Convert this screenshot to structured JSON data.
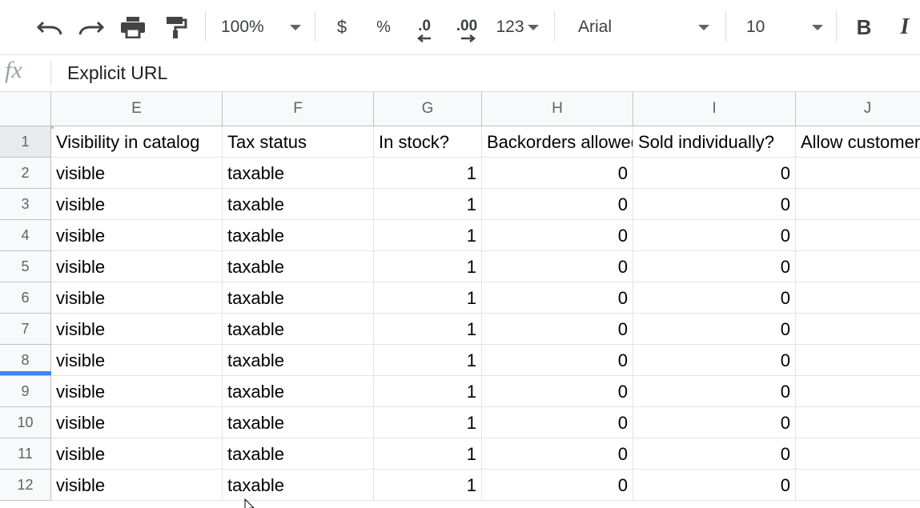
{
  "toolbar": {
    "undo_icon": "undo-icon",
    "redo_icon": "redo-icon",
    "print_icon": "print-icon",
    "paint_format_icon": "paint-format-icon",
    "zoom": "100%",
    "currency": "$",
    "percent": "%",
    "decrease_decimal": ".0",
    "increase_decimal": ".00",
    "more_formats": "123",
    "font": "Arial",
    "font_size": "10",
    "bold": "B",
    "italic": "I"
  },
  "formula_bar": {
    "fx": "fx",
    "value": "Explicit URL"
  },
  "columns": [
    "E",
    "F",
    "G",
    "H",
    "I",
    "J"
  ],
  "rows": [
    {
      "num": "1",
      "cells": [
        "Visibility in catalog",
        "Tax status",
        "In stock?",
        "Backorders allowed?",
        "Sold individually?",
        "Allow customer reviews?"
      ]
    },
    {
      "num": "2",
      "cells": [
        "visible",
        "taxable",
        "1",
        "0",
        "0",
        ""
      ]
    },
    {
      "num": "3",
      "cells": [
        "visible",
        "taxable",
        "1",
        "0",
        "0",
        ""
      ]
    },
    {
      "num": "4",
      "cells": [
        "visible",
        "taxable",
        "1",
        "0",
        "0",
        ""
      ]
    },
    {
      "num": "5",
      "cells": [
        "visible",
        "taxable",
        "1",
        "0",
        "0",
        ""
      ]
    },
    {
      "num": "6",
      "cells": [
        "visible",
        "taxable",
        "1",
        "0",
        "0",
        ""
      ]
    },
    {
      "num": "7",
      "cells": [
        "visible",
        "taxable",
        "1",
        "0",
        "0",
        ""
      ]
    },
    {
      "num": "8",
      "cells": [
        "visible",
        "taxable",
        "1",
        "0",
        "0",
        ""
      ]
    },
    {
      "num": "9",
      "cells": [
        "visible",
        "taxable",
        "1",
        "0",
        "0",
        ""
      ]
    },
    {
      "num": "10",
      "cells": [
        "visible",
        "taxable",
        "1",
        "0",
        "0",
        ""
      ]
    },
    {
      "num": "11",
      "cells": [
        "visible",
        "taxable",
        "1",
        "0",
        "0",
        ""
      ]
    },
    {
      "num": "12",
      "cells": [
        "visible",
        "taxable",
        "1",
        "0",
        "0",
        ""
      ]
    }
  ],
  "colors": {
    "header_bg": "#f8f9fa",
    "gridline": "#e2e3e3",
    "selection_blue": "#4285f4"
  }
}
